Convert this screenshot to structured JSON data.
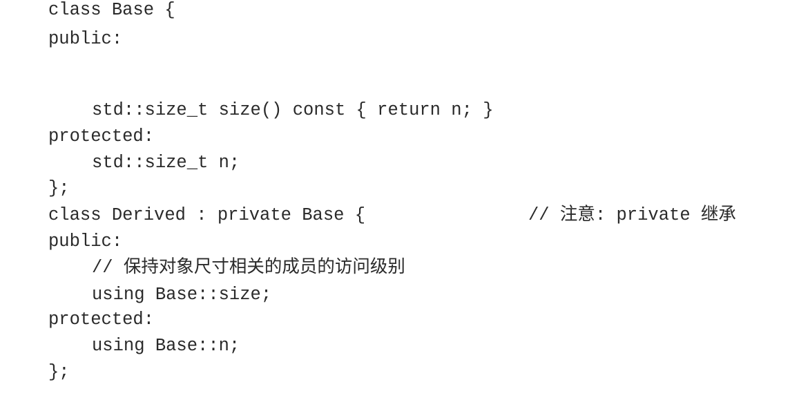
{
  "code_lines": [
    "class Base {",
    "public:",
    "std::size_t size() const { return n; }",
    "protected:",
    "std::size_t n;",
    "};",
    "class Derived : private Base {",
    "public:",
    "// 保持对象尺寸相关的成员的访问级别",
    "using Base::size;",
    "protected:",
    "using Base::n;",
    "};"
  ],
  "comment_private_inheritance": "// 注意: private 继承"
}
